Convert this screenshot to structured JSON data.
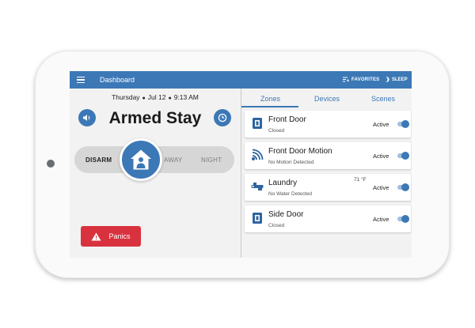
{
  "header": {
    "title": "Dashboard",
    "favorites_label": "FAVORITES",
    "sleep_label": "SLEEP"
  },
  "status": {
    "day": "Thursday",
    "date": "Jul 12",
    "time": "9:13 AM",
    "arm_state": "Armed Stay"
  },
  "arm_modes": [
    "DISARM",
    "AWAY",
    "NIGHT"
  ],
  "panics_label": "Panics",
  "tabs": [
    "Zones",
    "Devices",
    "Scenes"
  ],
  "zones": [
    {
      "name": "Front Door",
      "state": "Closed",
      "status": "Active",
      "temp": "",
      "icon": "door-sensor-icon",
      "toggle_on": true
    },
    {
      "name": "Front Door Motion",
      "state": "No Motion Detected",
      "status": "Active",
      "temp": "",
      "icon": "motion-sensor-icon",
      "toggle_on": true
    },
    {
      "name": "Laundry",
      "state": "No Water Detected",
      "status": "Active",
      "temp": "71 °F",
      "icon": "water-sensor-icon",
      "toggle_on": true
    },
    {
      "name": "Side Door",
      "state": "Closed",
      "status": "Active",
      "temp": "",
      "icon": "door-sensor-icon",
      "toggle_on": true
    }
  ],
  "colors": {
    "accent": "#3c78b6",
    "panic": "#d9323f",
    "background": "#f2f2f2"
  }
}
